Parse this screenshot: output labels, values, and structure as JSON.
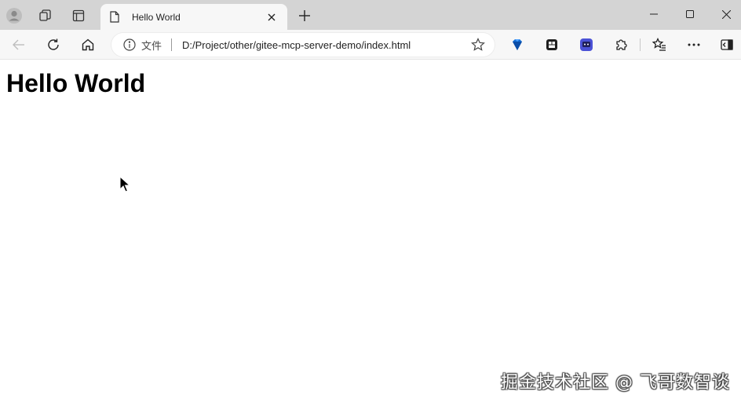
{
  "tab": {
    "title": "Hello World"
  },
  "address_bar": {
    "site_label": "文件",
    "url": "D:/Project/other/gitee-mcp-server-demo/index.html"
  },
  "page": {
    "heading": "Hello World"
  },
  "watermark": {
    "text": "掘金技术社区 @ 飞哥数智谈"
  },
  "colors": {
    "titlebar": "#d4d4d4",
    "toolbar": "#f7f7f7",
    "ext_blue": "#1470d8",
    "ext_purple": "#4b52d6"
  }
}
